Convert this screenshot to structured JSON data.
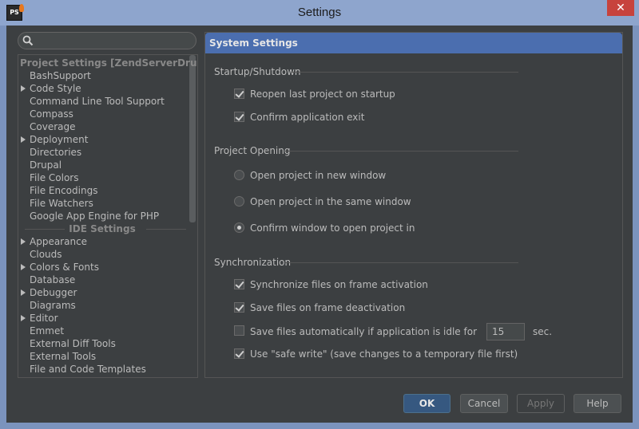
{
  "window": {
    "title": "Settings",
    "app_icon_text": "PS",
    "close_glyph": "✕"
  },
  "search": {
    "placeholder": "",
    "value": ""
  },
  "tree": {
    "project_header": "Project Settings [ZendServerDrupal]",
    "project_items": [
      {
        "label": "BashSupport",
        "expandable": false
      },
      {
        "label": "Code Style",
        "expandable": true
      },
      {
        "label": "Command Line Tool Support",
        "expandable": false
      },
      {
        "label": "Compass",
        "expandable": false
      },
      {
        "label": "Coverage",
        "expandable": false
      },
      {
        "label": "Deployment",
        "expandable": true
      },
      {
        "label": "Directories",
        "expandable": false
      },
      {
        "label": "Drupal",
        "expandable": false
      },
      {
        "label": "File Colors",
        "expandable": false
      },
      {
        "label": "File Encodings",
        "expandable": false
      },
      {
        "label": "File Watchers",
        "expandable": false
      },
      {
        "label": "Google App Engine for PHP",
        "expandable": false
      }
    ],
    "ide_header": "IDE Settings",
    "ide_items": [
      {
        "label": "Appearance",
        "expandable": true
      },
      {
        "label": "Clouds",
        "expandable": false
      },
      {
        "label": "Colors & Fonts",
        "expandable": true
      },
      {
        "label": "Database",
        "expandable": false
      },
      {
        "label": "Debugger",
        "expandable": true
      },
      {
        "label": "Diagrams",
        "expandable": false
      },
      {
        "label": "Editor",
        "expandable": true
      },
      {
        "label": "Emmet",
        "expandable": false
      },
      {
        "label": "External Diff Tools",
        "expandable": false
      },
      {
        "label": "External Tools",
        "expandable": false
      },
      {
        "label": "File and Code Templates",
        "expandable": false
      }
    ]
  },
  "panel": {
    "title": "System Settings",
    "startup": {
      "title": "Startup/Shutdown",
      "reopen_label": "Reopen last project on startup",
      "reopen_checked": true,
      "confirm_exit_label": "Confirm application exit",
      "confirm_exit_checked": true
    },
    "project_opening": {
      "title": "Project Opening",
      "new_window_label": "Open project in new window",
      "same_window_label": "Open project in the same window",
      "confirm_label": "Confirm window to open project in",
      "selected": "confirm"
    },
    "sync": {
      "title": "Synchronization",
      "sync_label": "Synchronize files on frame activation",
      "sync_checked": true,
      "save_deactivation_label": "Save files on frame deactivation",
      "save_deactivation_checked": true,
      "save_idle_label": "Save files automatically if application is idle for",
      "save_idle_checked": false,
      "idle_value": "15",
      "idle_unit": "sec.",
      "safe_write_label": "Use \"safe write\" (save changes to a temporary file first)",
      "safe_write_checked": true
    }
  },
  "buttons": {
    "ok": "OK",
    "cancel": "Cancel",
    "apply": "Apply",
    "help": "Help"
  },
  "colors": {
    "header_accent": "#4b6eaf",
    "background": "#3c3f41",
    "text": "#bbbbbb"
  }
}
